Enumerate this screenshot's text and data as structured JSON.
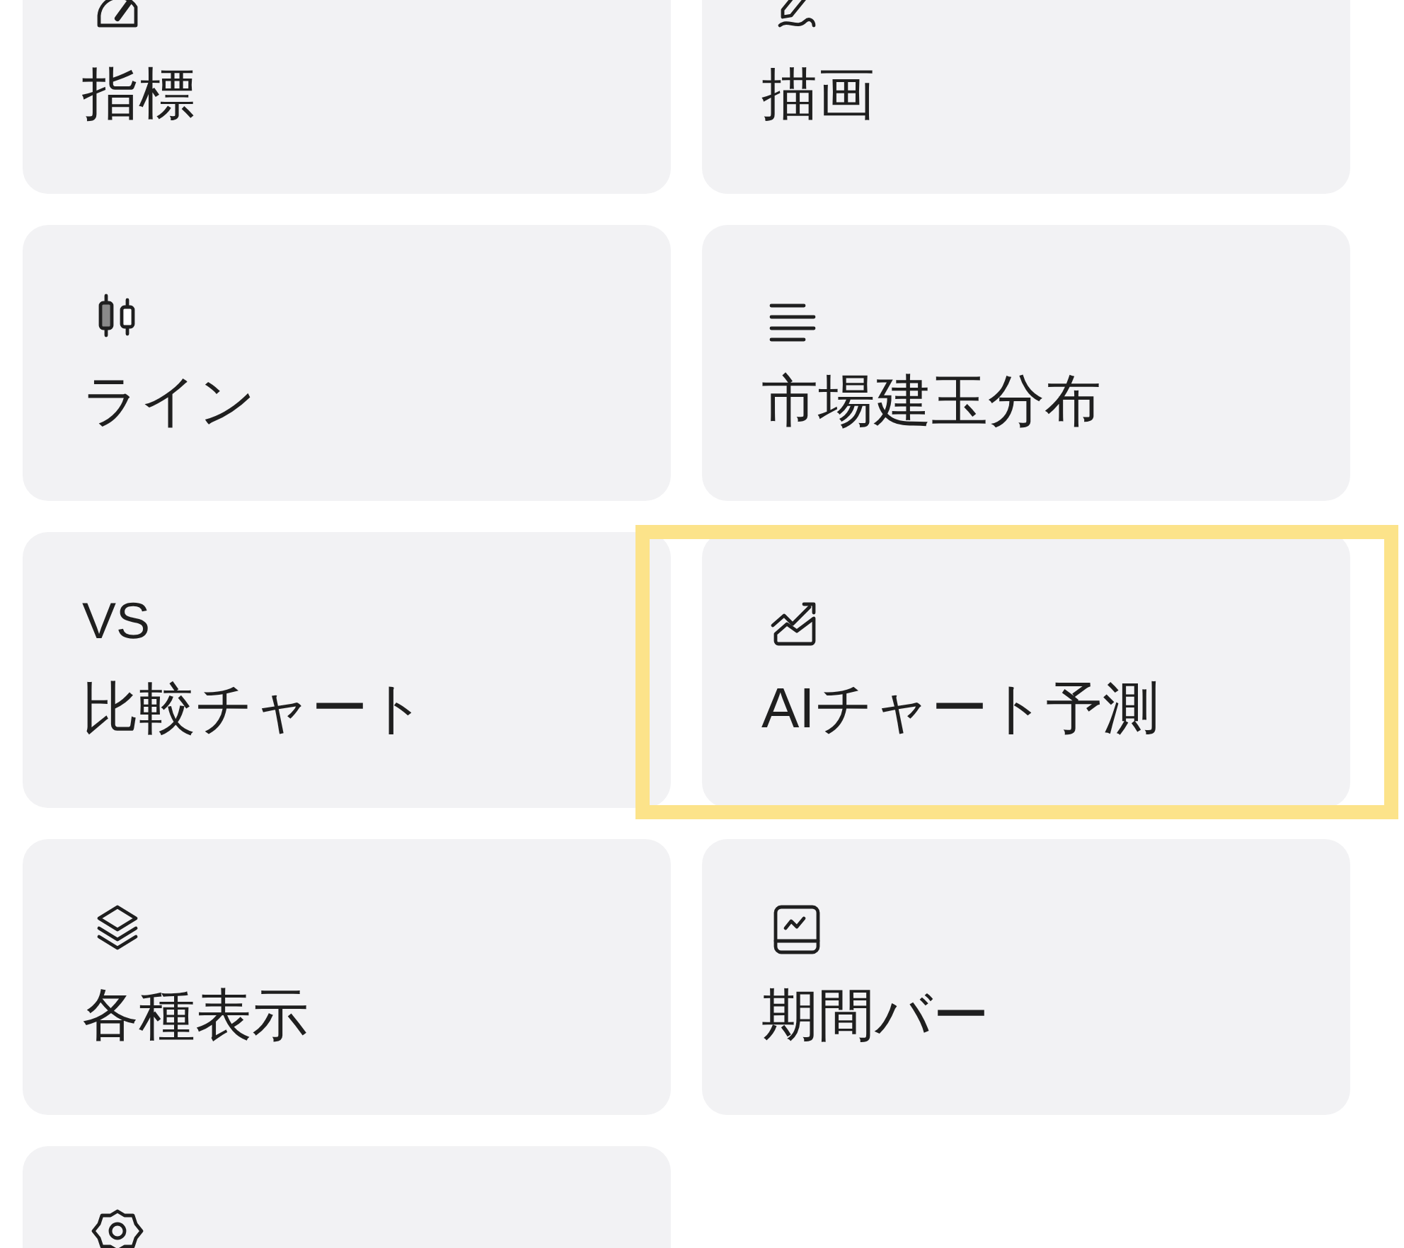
{
  "menu_items": [
    {
      "kind": "gauge",
      "label": "指標",
      "highlighted": false
    },
    {
      "kind": "pen",
      "label": "描画",
      "highlighted": false
    },
    {
      "kind": "candles",
      "label": "ライン",
      "highlighted": false
    },
    {
      "kind": "lines",
      "label": "市場建玉分布",
      "highlighted": false
    },
    {
      "kind": "vs",
      "icon_text": "VS",
      "label": "比較チャート",
      "highlighted": false
    },
    {
      "kind": "trend",
      "label": "AIチャート予測",
      "highlighted": true
    },
    {
      "kind": "layers",
      "label": "各種表示",
      "highlighted": false
    },
    {
      "kind": "panel",
      "label": "期間バー",
      "highlighted": false
    },
    {
      "kind": "gear",
      "highlighted": false
    }
  ]
}
